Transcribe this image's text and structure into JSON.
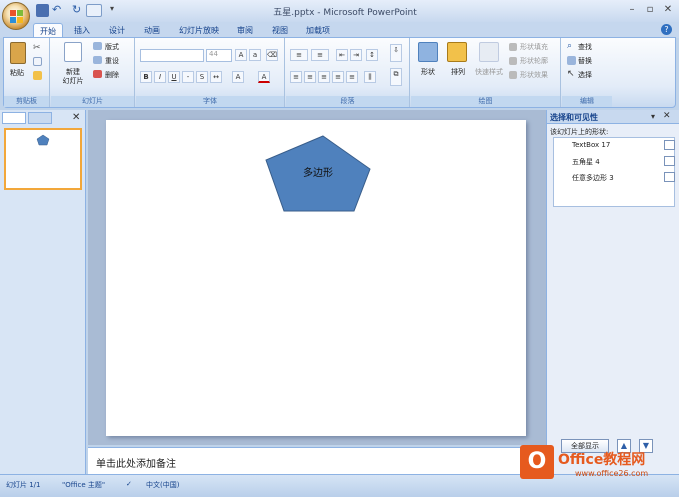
{
  "window": {
    "title": "五星.pptx - Microsoft PowerPoint"
  },
  "tabs": [
    "开始",
    "插入",
    "设计",
    "动画",
    "幻灯片放映",
    "审阅",
    "视图",
    "加载项"
  ],
  "ribbon": {
    "clipboard": {
      "paste": "粘贴",
      "label": "剪贴板"
    },
    "slides": {
      "new_slide": "新建",
      "new_slide2": "幻灯片",
      "layout": "版式",
      "reset": "重设",
      "delete": "删除",
      "label": "幻灯片"
    },
    "font": {
      "size": "44",
      "label": "字体"
    },
    "paragraph": {
      "label": "段落"
    },
    "drawing": {
      "shape": "形状",
      "arrange": "排列",
      "quick_styles": "快速样式",
      "fill": "形状填充",
      "outline": "形状轮廓",
      "effects": "形状效果",
      "label": "绘图"
    },
    "editing": {
      "find": "查找",
      "replace": "替换",
      "select": "选择",
      "label": "编辑"
    }
  },
  "slide": {
    "shape_text": "多边形"
  },
  "notes": {
    "placeholder": "单击此处添加备注"
  },
  "selection_pane": {
    "title": "选择和可见性",
    "subtitle": "该幻灯片上的形状:",
    "items": [
      "TextBox 17",
      "五角星 4",
      "任意多边形 3"
    ],
    "show_all": "全部显示"
  },
  "status": {
    "slide": "幻灯片 1/1",
    "theme": "\"Office 主题\"",
    "language": "中文(中国)"
  },
  "watermark": {
    "brand": "Office教程网",
    "url": "www.office26.com"
  },
  "colors": {
    "shape_fill": "#4f81bd",
    "shape_stroke": "#385d8a",
    "accent": "#f2a73a"
  }
}
